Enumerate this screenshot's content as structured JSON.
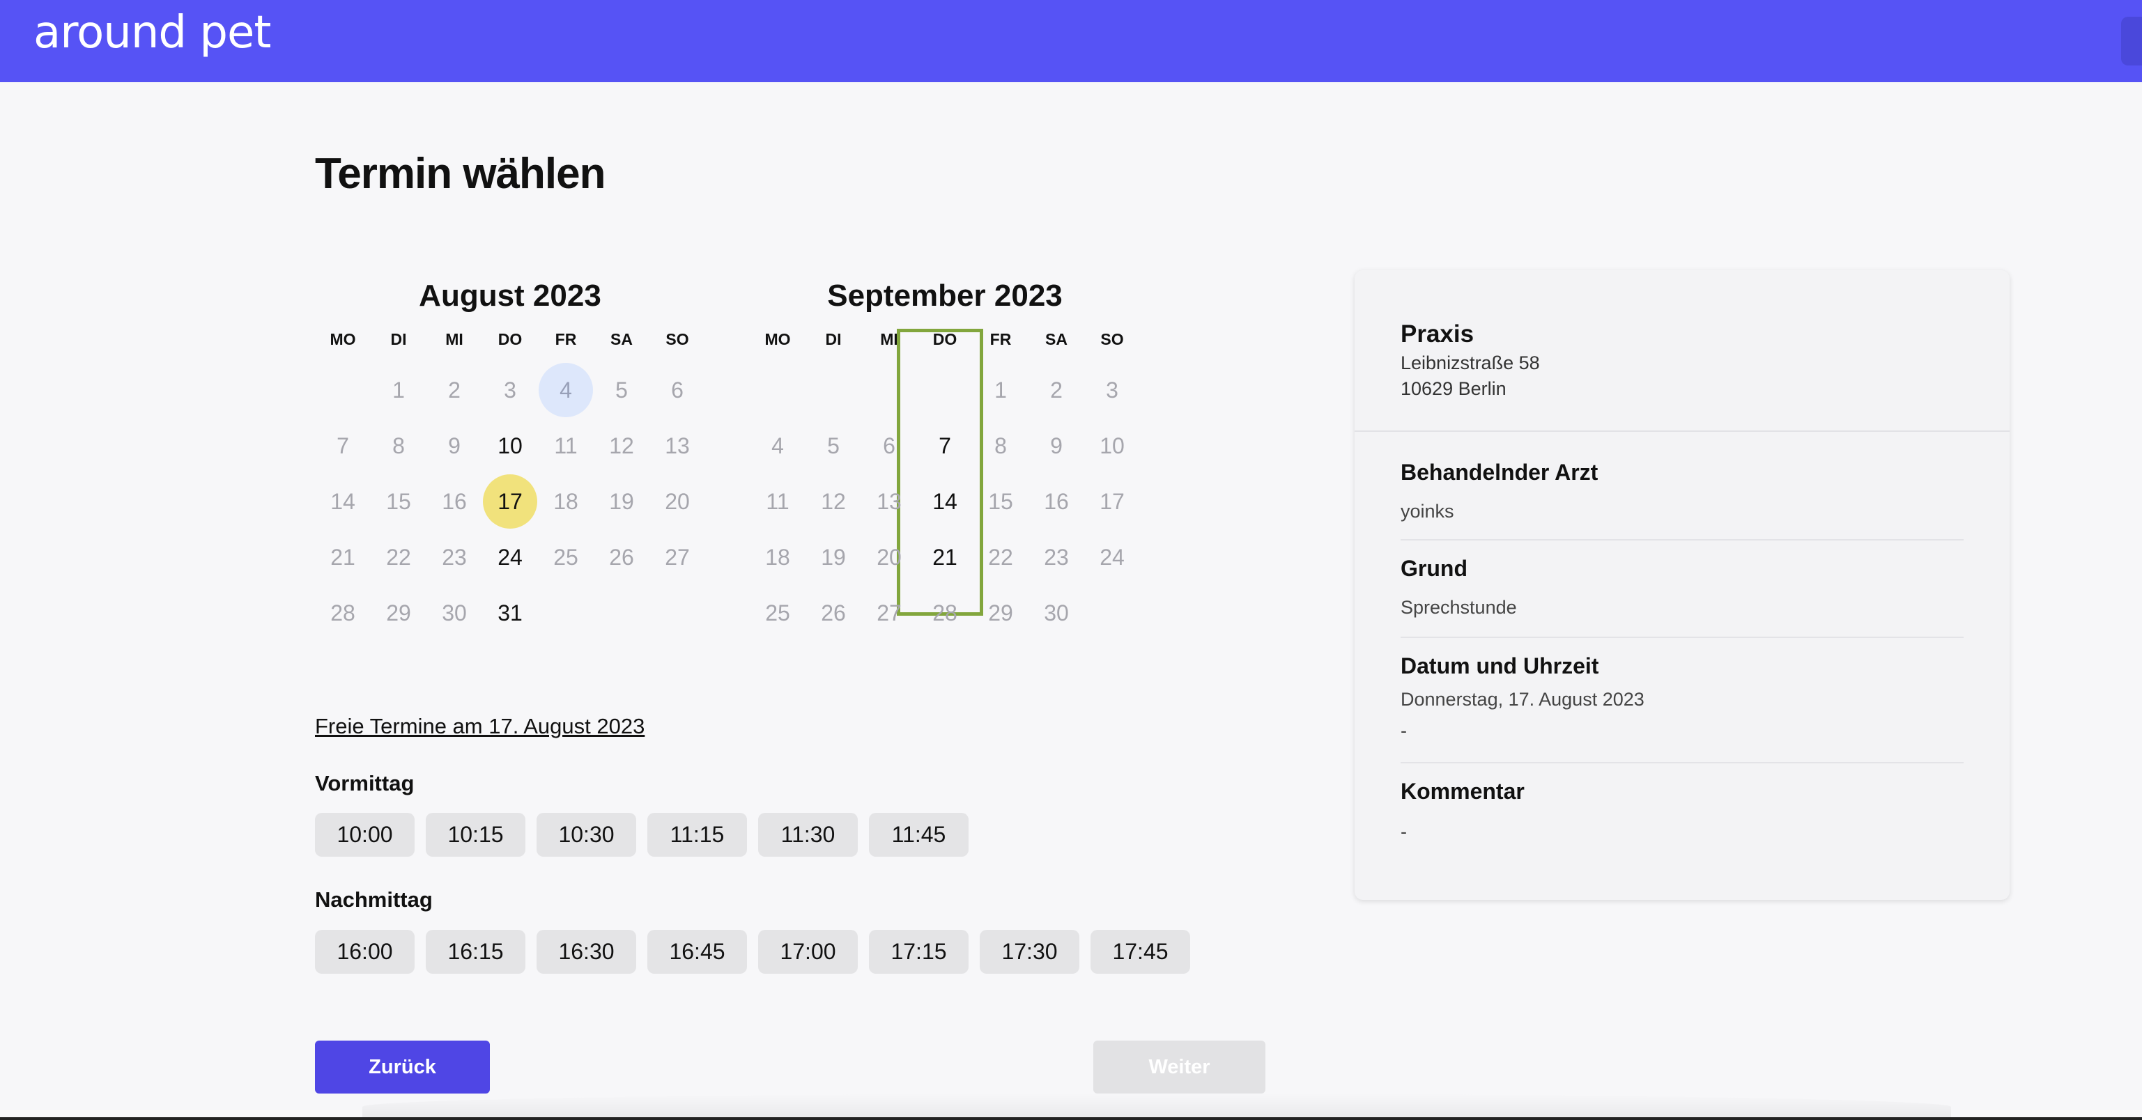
{
  "brand": {
    "logo": "around pet",
    "primary_color": "#5653f5",
    "highlight_color": "#f1e27c",
    "frame_color": "#82a63d"
  },
  "page": {
    "title": "Termin wählen"
  },
  "calendar": {
    "weekdays": [
      "MO",
      "DI",
      "MI",
      "DO",
      "FR",
      "SA",
      "SO"
    ],
    "months": [
      {
        "title": "August 2023",
        "weeks": [
          [
            null,
            "1",
            "2",
            "3",
            "4",
            "5",
            "6"
          ],
          [
            "7",
            "8",
            "9",
            "10",
            "11",
            "12",
            "13"
          ],
          [
            "14",
            "15",
            "16",
            "17",
            "18",
            "19",
            "20"
          ],
          [
            "21",
            "22",
            "23",
            "24",
            "25",
            "26",
            "27"
          ],
          [
            "28",
            "29",
            "30",
            "31",
            null,
            null,
            null
          ]
        ],
        "available": [
          "10",
          "17",
          "24",
          "31"
        ],
        "today": "4",
        "selected": "17"
      },
      {
        "title": "September 2023",
        "weeks": [
          [
            null,
            null,
            null,
            null,
            "1",
            "2",
            "3"
          ],
          [
            "4",
            "5",
            "6",
            "7",
            "8",
            "9",
            "10"
          ],
          [
            "11",
            "12",
            "13",
            "14",
            "15",
            "16",
            "17"
          ],
          [
            "18",
            "19",
            "20",
            "21",
            "22",
            "23",
            "24"
          ],
          [
            "25",
            "26",
            "27",
            "28",
            "29",
            "30",
            null
          ]
        ],
        "available": [
          "7",
          "14",
          "21"
        ],
        "today": null,
        "selected": null
      }
    ]
  },
  "slots": {
    "title": "Freie Termine am 17. August 2023",
    "morning_label": "Vormittag",
    "morning": [
      "10:00",
      "10:15",
      "10:30",
      "11:15",
      "11:30",
      "11:45"
    ],
    "afternoon_label": "Nachmittag",
    "afternoon": [
      "16:00",
      "16:15",
      "16:30",
      "16:45",
      "17:00",
      "17:15",
      "17:30",
      "17:45"
    ]
  },
  "nav": {
    "back_label": "Zurück",
    "next_label": "Weiter"
  },
  "summary": {
    "practice_title": "Praxis",
    "address_line1": "Leibnizstraße 58",
    "address_line2": "10629 Berlin",
    "sections": [
      {
        "label": "Behandelnder Arzt",
        "lines": [
          "yoinks"
        ]
      },
      {
        "label": "Grund",
        "lines": [
          "Sprechstunde"
        ]
      },
      {
        "label": "Datum und Uhrzeit",
        "lines": [
          "Donnerstag, 17. August 2023",
          "-"
        ]
      },
      {
        "label": "Kommentar",
        "lines": [
          "-"
        ]
      }
    ]
  }
}
